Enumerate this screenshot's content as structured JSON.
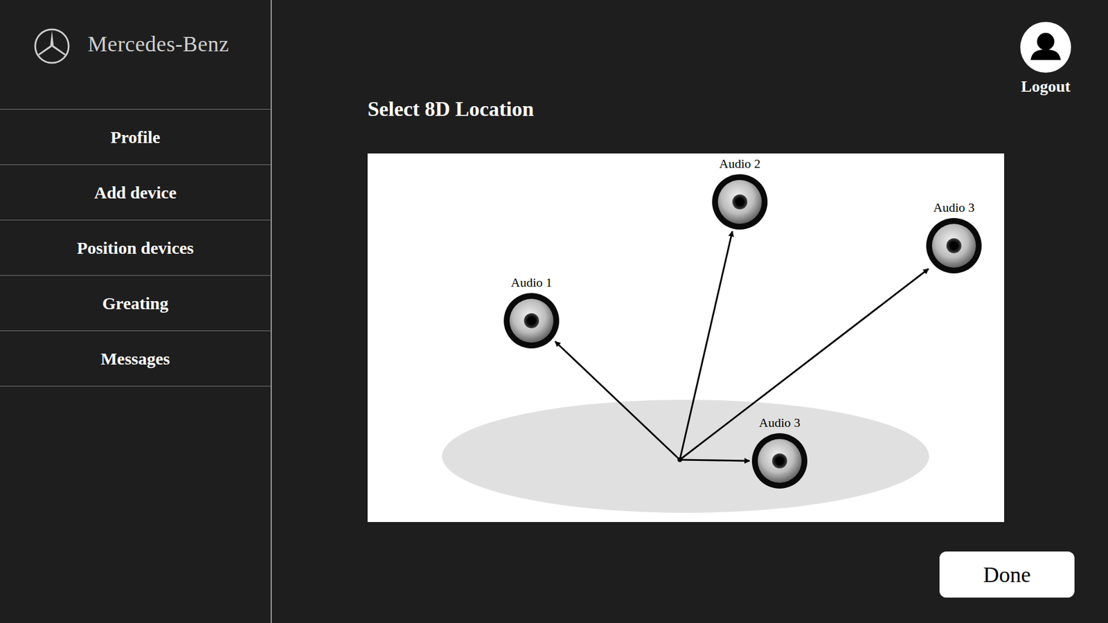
{
  "sidebar": {
    "brand": "Mercedes-Benz",
    "items": [
      {
        "label": "Profile"
      },
      {
        "label": "Add device"
      },
      {
        "label": "Position devices"
      },
      {
        "label": "Greating"
      },
      {
        "label": "Messages"
      }
    ]
  },
  "user": {
    "label": "Logout"
  },
  "title": "Select 8D Location",
  "speakers": [
    {
      "label": "Audio 1"
    },
    {
      "label": "Audio 2"
    },
    {
      "label": "Audio 3"
    },
    {
      "label": "Audio 3"
    }
  ],
  "buttons": [
    "Done"
  ]
}
